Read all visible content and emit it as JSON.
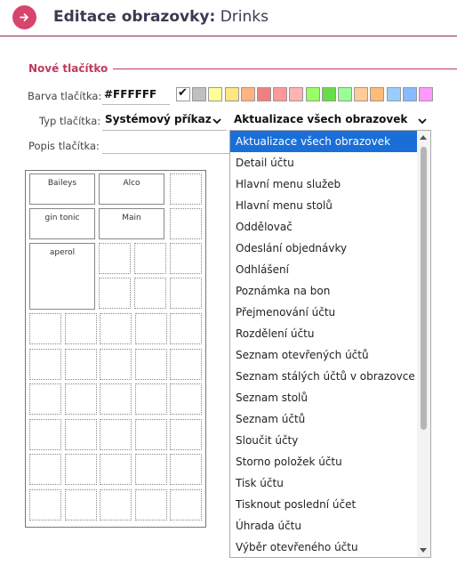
{
  "header": {
    "title_bold": "Editace obrazovky:",
    "title_name": "Drinks"
  },
  "section": {
    "title": "Nové tlačítko"
  },
  "form": {
    "color_label": "Barva tlačítka:",
    "color_value": "#FFFFFF",
    "type_label": "Typ tlačítka:",
    "type_value": "Systémový příkaz",
    "command_value": "Aktualizace všech obrazovek",
    "desc_label": "Popis tlačítka:"
  },
  "palette": [
    "#ffffff",
    "#c0c0c0",
    "#ffff99",
    "#ffe680",
    "#ffb380",
    "#f08080",
    "#ff9999",
    "#ffb3b3",
    "#99ff66",
    "#66dd44",
    "#99ff99",
    "#ffcc99",
    "#ffbb77",
    "#99ccff",
    "#88bbff",
    "#ff99ff"
  ],
  "grid_buttons": [
    {
      "label": "Baileys"
    },
    {
      "label": "Alco"
    },
    {
      "label": "gin tonic"
    },
    {
      "label": "Main"
    },
    {
      "label": "aperol"
    }
  ],
  "dropdown": {
    "selected_index": 0,
    "options": [
      "Aktualizace všech obrazovek",
      "Detail účtu",
      "Hlavní menu služeb",
      "Hlavní menu stolů",
      "Oddělovač",
      "Odeslání objednávky",
      "Odhlášení",
      "Poznámka na bon",
      "Přejmenování účtu",
      "Rozdělení účtu",
      "Seznam otevřených účtů",
      "Seznam stálých účtů v obrazovce",
      "Seznam stolů",
      "Seznam účtů",
      "Sloučit účty",
      "Storno položek účtu",
      "Tisk účtu",
      "Tisknout poslední účet",
      "Úhrada účtu",
      "Výběr otevřeného účtu"
    ]
  }
}
